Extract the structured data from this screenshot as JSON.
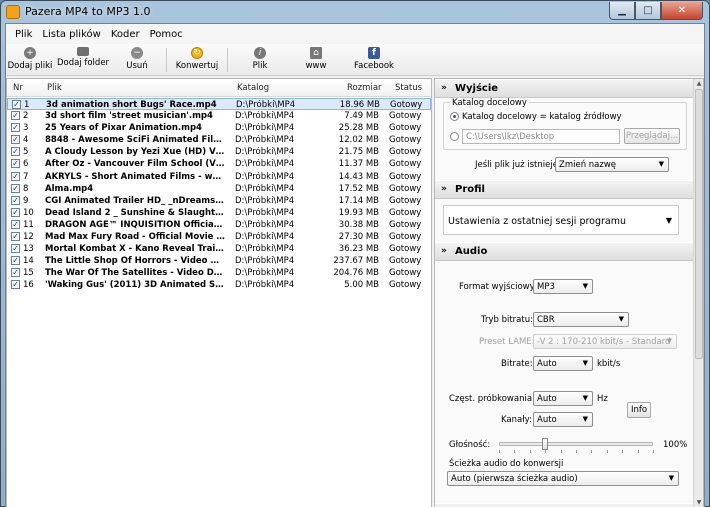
{
  "window": {
    "title": "Pazera MP4 to MP3 1.0"
  },
  "menu": [
    "Plik",
    "Lista plików",
    "Koder",
    "Pomoc"
  ],
  "toolbar": {
    "add_files": "Dodaj pliki",
    "add_folder": "Dodaj folder",
    "remove": "Usuń",
    "convert": "Konwertuj",
    "file": "Plik",
    "www": "www",
    "facebook": "Facebook"
  },
  "list": {
    "headers": {
      "nr": "Nr",
      "file": "Plik",
      "dir": "Katalog",
      "size": "Rozmiar",
      "status": "Status"
    },
    "rows": [
      {
        "nr": "1",
        "file": "3d animation short Bugs' Race.mp4",
        "dir": "D:\\Próbki\\MP4",
        "size": "18.96 MB",
        "status": "Gotowy"
      },
      {
        "nr": "2",
        "file": "3d short film 'street musician'.mp4",
        "dir": "D:\\Próbki\\MP4",
        "size": "7.49 MB",
        "status": "Gotowy"
      },
      {
        "nr": "3",
        "file": "25 Years of Pixar Animation.mp4",
        "dir": "D:\\Próbki\\MP4",
        "size": "25.28 MB",
        "status": "Gotowy"
      },
      {
        "nr": "4",
        "file": "8848 - Awesome SciFi Animated Film B...",
        "dir": "D:\\Próbki\\MP4",
        "size": "12.02 MB",
        "status": "Gotowy"
      },
      {
        "nr": "5",
        "file": "A Cloudy Lesson by Yezi Xue (HD) VER...",
        "dir": "D:\\Próbki\\MP4",
        "size": "21.75 MB",
        "status": "Gotowy"
      },
      {
        "nr": "6",
        "file": "After Oz - Vancouver Film School (VFS)...",
        "dir": "D:\\Próbki\\MP4",
        "size": "11.37 MB",
        "status": "Gotowy"
      },
      {
        "nr": "7",
        "file": "AKRYLS - Short Animated Films - www....",
        "dir": "D:\\Próbki\\MP4",
        "size": "14.43 MB",
        "status": "Gotowy"
      },
      {
        "nr": "8",
        "file": "Alma.mp4",
        "dir": "D:\\Próbki\\MP4",
        "size": "17.52 MB",
        "status": "Gotowy"
      },
      {
        "nr": "9",
        "file": "CGI Animated Trailer HD_ _nDreams T...",
        "dir": "D:\\Próbki\\MP4",
        "size": "17.14 MB",
        "status": "Gotowy"
      },
      {
        "nr": "10",
        "file": "Dead Island 2 _ Sunshine & Slaughter ...",
        "dir": "D:\\Próbki\\MP4",
        "size": "19.93 MB",
        "status": "Gotowy"
      },
      {
        "nr": "11",
        "file": "DRAGON AGE™ INQUISITION Official T...",
        "dir": "D:\\Próbki\\MP4",
        "size": "30.38 MB",
        "status": "Gotowy"
      },
      {
        "nr": "12",
        "file": "Mad Max Fury Road - Official Movie Tr...",
        "dir": "D:\\Próbki\\MP4",
        "size": "27.30 MB",
        "status": "Gotowy"
      },
      {
        "nr": "13",
        "file": "Mortal Kombat X - Kano Reveal Trailer...",
        "dir": "D:\\Próbki\\MP4",
        "size": "36.23 MB",
        "status": "Gotowy"
      },
      {
        "nr": "14",
        "file": "The Little Shop Of Horrors - Video Dail...",
        "dir": "D:\\Próbki\\MP4",
        "size": "237.67 MB",
        "status": "Gotowy"
      },
      {
        "nr": "15",
        "file": "The War Of The Satellites - Video Daily...",
        "dir": "D:\\Próbki\\MP4",
        "size": "204.76 MB",
        "status": "Gotowy"
      },
      {
        "nr": "16",
        "file": "'Waking Gus' (2011) 3D Animated Sho...",
        "dir": "D:\\Próbki\\MP4",
        "size": "5.00 MB",
        "status": "Gotowy"
      }
    ]
  },
  "output": {
    "title": "Wyjście",
    "group_title": "Katalog docelowy",
    "radio_same": "Katalog docelowy = katalog źródłowy",
    "path": "C:\\Users\\Ikz\\Desktop",
    "browse": "Przeglądaj...",
    "exists_label": "Jeśli plik już istnieje:",
    "exists_value": "Zmień nazwę"
  },
  "profile": {
    "title": "Profil",
    "value": "Ustawienia z ostatniej sesji programu"
  },
  "audio": {
    "title": "Audio",
    "format_label": "Format wyjściowy:",
    "format_value": "MP3",
    "bitrate_mode_label": "Tryb bitratu:",
    "bitrate_mode_value": "CBR",
    "lame_label": "Preset LAME:",
    "lame_value": "-V 2 : 170-210 kbit/s - Standard",
    "bitrate_label": "Bitrate:",
    "bitrate_value": "Auto",
    "bitrate_unit": "kbit/s",
    "samplerate_label": "Częst. próbkowania:",
    "samplerate_value": "Auto",
    "samplerate_unit": "Hz",
    "channels_label": "Kanały:",
    "channels_value": "Auto",
    "info": "Info",
    "volume_label": "Głośność:",
    "volume_value": "100%",
    "volume_level": 0.3,
    "track_label": "Ścieżka audio do konwersji",
    "track_value": "Auto (pierwsza ścieżka audio)"
  }
}
